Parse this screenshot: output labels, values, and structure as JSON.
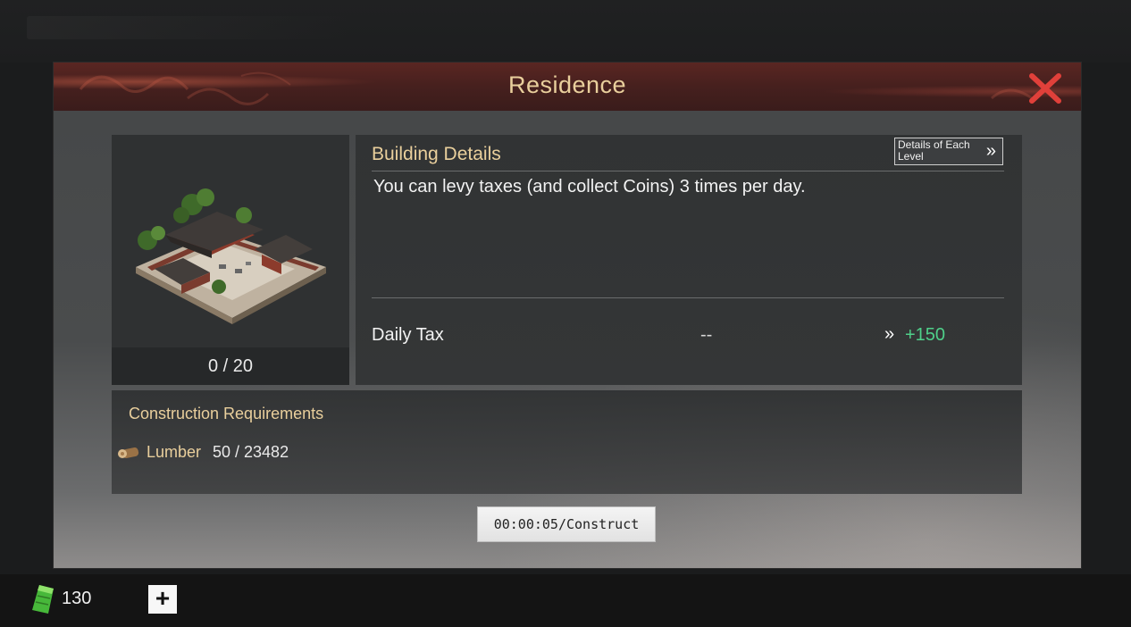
{
  "dialog": {
    "title": "Residence",
    "close_icon": "close-x-icon"
  },
  "building": {
    "image_icon": "residence-building-icon",
    "level": "0 / 20"
  },
  "details": {
    "heading": "Building Details",
    "levels_button": "Details of Each Level",
    "levels_button_icon": "double-chevron-right-icon",
    "description": "You can levy taxes (and collect Coins) 3 times per day.",
    "stat_label": "Daily Tax",
    "current_value": "--",
    "next_value": "+150",
    "next_arrow": "»"
  },
  "requirements": {
    "heading": "Construction Requirements",
    "items": [
      {
        "icon": "lumber-icon",
        "name": "Lumber",
        "value": "50 / 23482"
      }
    ]
  },
  "construct_button": "00:00:05/Construct",
  "currency": {
    "icon": "jade-icon",
    "amount": "130",
    "add_label": "+"
  },
  "colors": {
    "accent_gold": "#e9cf9c",
    "positive_green": "#4fd08a",
    "close_red": "#e0403a"
  }
}
